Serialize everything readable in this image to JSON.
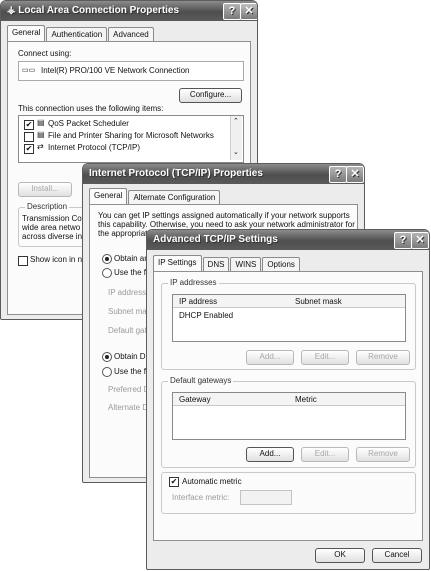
{
  "lac": {
    "title": "Local Area Connection Properties",
    "tabs": [
      "General",
      "Authentication",
      "Advanced"
    ],
    "connect_using_label": "Connect using:",
    "adapter": "Intel(R) PRO/100 VE Network Connection",
    "configure_button": "Configure...",
    "items_label": "This connection uses the following items:",
    "items": [
      {
        "label": "QoS Packet Scheduler",
        "checked": true
      },
      {
        "label": "File and Printer Sharing for Microsoft Networks",
        "checked": false
      },
      {
        "label": "Internet Protocol (TCP/IP)",
        "checked": true
      }
    ],
    "install_button": "Install...",
    "description_label": "Description",
    "description_lines": [
      "Transmission Cor",
      "wide area netwo",
      "across diverse in"
    ],
    "show_icon_label": "Show icon in no"
  },
  "tcpip": {
    "title": "Internet Protocol (TCP/IP) Properties",
    "tabs": [
      "General",
      "Alternate Configuration"
    ],
    "intro_lines": [
      "You can get IP settings assigned automatically if your network supports",
      "this capability. Otherwise, you need to ask your network administrator for",
      "the appropriate"
    ],
    "obtain_ip": "Obtain ar",
    "use_following_ip": "Use the f",
    "ip_address": "IP address",
    "subnet_mask": "Subnet mas",
    "default_gateway": "Default gat",
    "obtain_dns": "Obtain D",
    "use_following_dns": "Use the f",
    "preferred_dns": "Preferred D",
    "alternate_dns": "Alternate D"
  },
  "adv": {
    "title": "Advanced TCP/IP Settings",
    "tabs": [
      "IP Settings",
      "DNS",
      "WINS",
      "Options"
    ],
    "ip_group": "IP addresses",
    "ip_headers": [
      "IP address",
      "Subnet mask"
    ],
    "ip_rows": [
      "DHCP Enabled"
    ],
    "ip_buttons": [
      "Add...",
      "Edit...",
      "Remove"
    ],
    "gw_group": "Default gateways",
    "gw_headers": [
      "Gateway",
      "Metric"
    ],
    "gw_buttons": [
      "Add...",
      "Edit...",
      "Remove"
    ],
    "auto_metric": "Automatic metric",
    "auto_metric_checked": true,
    "interface_metric": "Interface metric:",
    "ok": "OK",
    "cancel": "Cancel"
  },
  "title_buttons": {
    "help": "?",
    "close": "✕"
  }
}
